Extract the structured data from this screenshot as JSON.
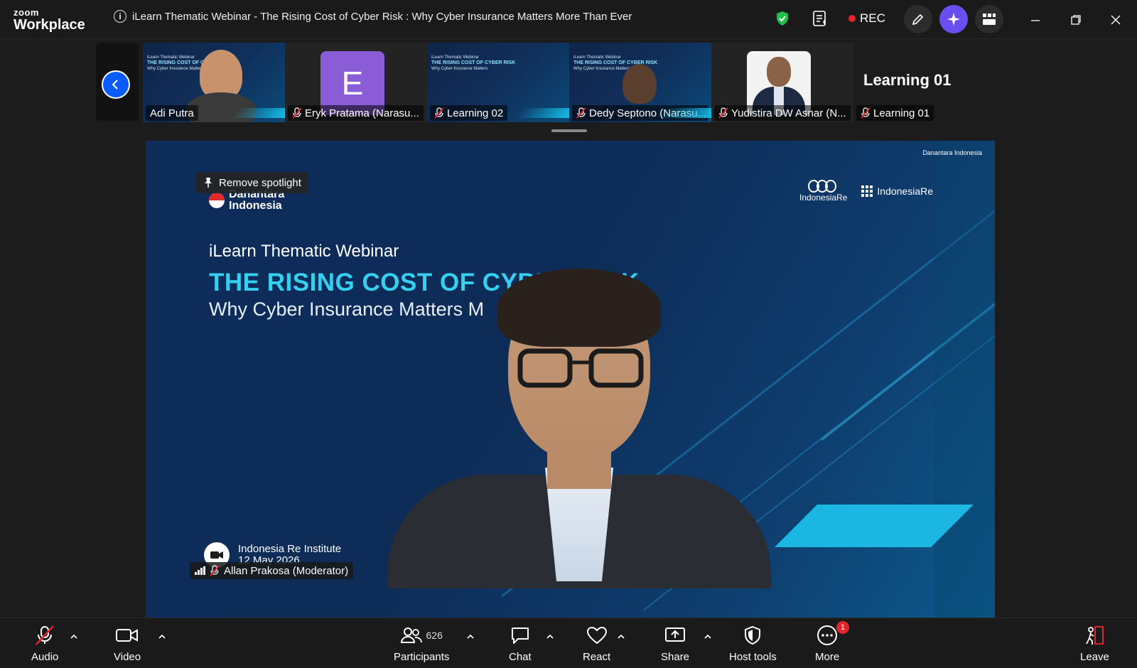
{
  "window": {
    "brand_line1": "zoom",
    "brand_line2": "Workplace",
    "meeting_title": "iLearn Thematic Webinar - The Rising Cost of Cyber Risk : Why Cyber Insurance Matters More Than Ever",
    "rec_label": "REC"
  },
  "thumbnails": [
    {
      "name": "Adi Putra",
      "muted": false,
      "kind": "video-slide"
    },
    {
      "name": "Eryk Pratama (Narasu...",
      "muted": true,
      "kind": "avatar",
      "initial": "E"
    },
    {
      "name": "Learning 02",
      "muted": true,
      "kind": "slide"
    },
    {
      "name": "Dedy Septono (Narasu...",
      "muted": true,
      "kind": "video-slide"
    },
    {
      "name": "Yudistira DW Asnar (N...",
      "muted": true,
      "kind": "photo"
    },
    {
      "name": "Learning 01",
      "muted": true,
      "kind": "label"
    }
  ],
  "side_label": "Learning 01",
  "thumb_slide_text": {
    "line1": "iLearn Thematic Webinar",
    "line2": "THE RISING COST OF C",
    "line3": "Why Cyber Insurance Matters"
  },
  "stage": {
    "spotlight_label": "Remove spotlight",
    "danantara_line1": "Danantara",
    "danantara_line2": "Indonesia",
    "slide_subtitle": "iLearn Thematic Webinar",
    "slide_title": "THE RISING COST OF CYBER RISK",
    "slide_subtitle2": "Why Cyber Insurance Matters M",
    "logo_ir": "IndonesiaRe",
    "logo_iri": "IndonesiaRe",
    "topright_brand": "Danantara Indonesia",
    "org_name": "Indonesia Re Institute",
    "org_date": "12 May 2026",
    "speaker_name": "Allan Prakosa (Moderator)"
  },
  "toolbar": {
    "audio": "Audio",
    "video": "Video",
    "participants": "Participants",
    "participants_count": "626",
    "chat": "Chat",
    "react": "React",
    "share": "Share",
    "host_tools": "Host tools",
    "more": "More",
    "more_badge": "1",
    "leave": "Leave"
  },
  "colors": {
    "accent_blue": "#0b5cff",
    "rec_red": "#e5232e",
    "slide_cyan": "#35d0f0",
    "ai_purple": "#6b4ef0"
  }
}
